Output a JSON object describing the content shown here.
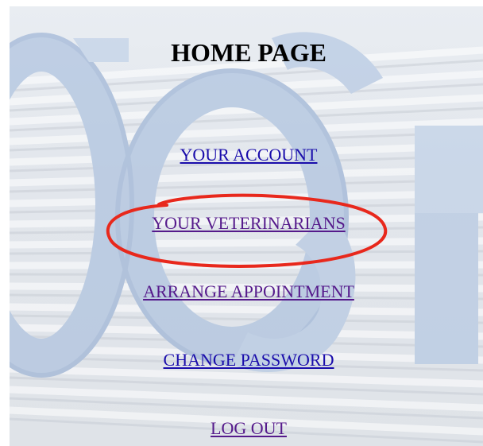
{
  "page": {
    "title": "HOME PAGE"
  },
  "nav": {
    "your_account": "YOUR ACCOUNT",
    "your_veterinarians": "YOUR VETERINARIANS",
    "arrange_appointment": "ARRANGE APPOINTMENT",
    "change_password": "CHANGE PASSWORD",
    "log_out": "LOG OUT"
  },
  "colors": {
    "link": "#1a0dab",
    "link_visited": "#551a8b",
    "annotation": "#e8281c",
    "background_letters": "#aec4e2"
  }
}
